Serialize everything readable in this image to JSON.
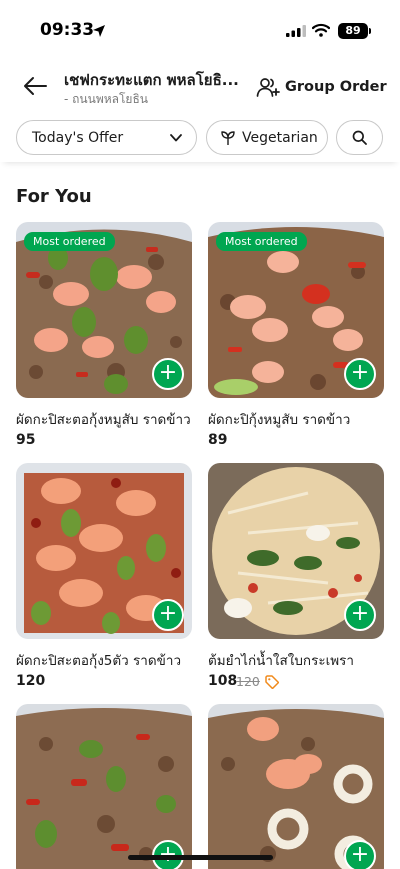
{
  "status_bar": {
    "time": "09:33",
    "battery": "89"
  },
  "header": {
    "store_name": "เชฟกระทะแตก พหลโยธิ...",
    "branch": "- ถนนพหลโยธิน",
    "group_order_label": "Group Order"
  },
  "filters": {
    "offer_label": "Today's Offer",
    "vegetarian_label": "Vegetarian"
  },
  "section": {
    "title": "For You"
  },
  "items": [
    {
      "name": "ผัดกะปิสะตอกุ้งหมูสับ ราดข้าว",
      "price": "95",
      "badge": "Most ordered"
    },
    {
      "name": "ผัดกะปิกุ้งหมูสับ ราดข้าว",
      "price": "89",
      "badge": "Most ordered"
    },
    {
      "name": "ผัดกะปิสะตอกุ้ง5ตัว ราดข้าว",
      "price": "120"
    },
    {
      "name": "ต้มยำไก่น้ำใสใบกระเพรา",
      "price": "108",
      "old_price": "120"
    },
    {
      "name": "",
      "price": ""
    },
    {
      "name": "",
      "price": ""
    }
  ],
  "colors": {
    "accent_green": "#00a651",
    "badge_green": "#00a650",
    "promo_orange": "#f08a1c"
  },
  "icons": {
    "back": "arrow-left-icon",
    "group": "group-add-icon",
    "chevron": "chevron-down-icon",
    "veg": "leaf-icon",
    "search": "search-icon",
    "add": "plus-icon",
    "promo": "tag-icon"
  }
}
